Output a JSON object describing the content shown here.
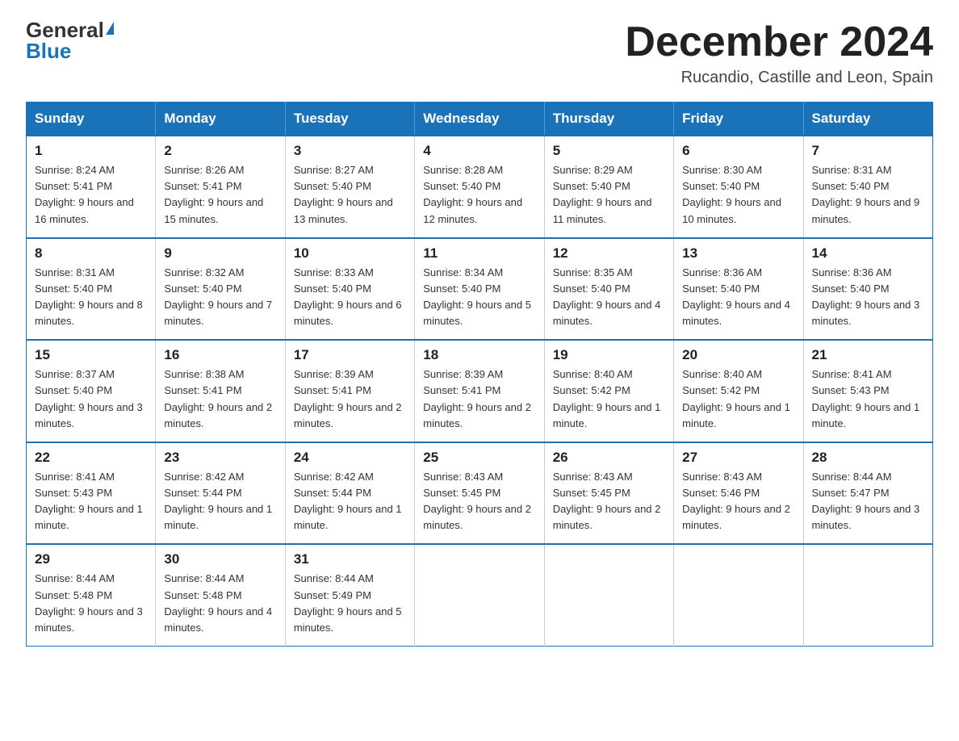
{
  "header": {
    "logo_general": "General",
    "logo_blue": "Blue",
    "month_title": "December 2024",
    "location": "Rucandio, Castille and Leon, Spain"
  },
  "days_of_week": [
    "Sunday",
    "Monday",
    "Tuesday",
    "Wednesday",
    "Thursday",
    "Friday",
    "Saturday"
  ],
  "weeks": [
    [
      {
        "num": "1",
        "sunrise": "8:24 AM",
        "sunset": "5:41 PM",
        "daylight": "9 hours and 16 minutes."
      },
      {
        "num": "2",
        "sunrise": "8:26 AM",
        "sunset": "5:41 PM",
        "daylight": "9 hours and 15 minutes."
      },
      {
        "num": "3",
        "sunrise": "8:27 AM",
        "sunset": "5:40 PM",
        "daylight": "9 hours and 13 minutes."
      },
      {
        "num": "4",
        "sunrise": "8:28 AM",
        "sunset": "5:40 PM",
        "daylight": "9 hours and 12 minutes."
      },
      {
        "num": "5",
        "sunrise": "8:29 AM",
        "sunset": "5:40 PM",
        "daylight": "9 hours and 11 minutes."
      },
      {
        "num": "6",
        "sunrise": "8:30 AM",
        "sunset": "5:40 PM",
        "daylight": "9 hours and 10 minutes."
      },
      {
        "num": "7",
        "sunrise": "8:31 AM",
        "sunset": "5:40 PM",
        "daylight": "9 hours and 9 minutes."
      }
    ],
    [
      {
        "num": "8",
        "sunrise": "8:31 AM",
        "sunset": "5:40 PM",
        "daylight": "9 hours and 8 minutes."
      },
      {
        "num": "9",
        "sunrise": "8:32 AM",
        "sunset": "5:40 PM",
        "daylight": "9 hours and 7 minutes."
      },
      {
        "num": "10",
        "sunrise": "8:33 AM",
        "sunset": "5:40 PM",
        "daylight": "9 hours and 6 minutes."
      },
      {
        "num": "11",
        "sunrise": "8:34 AM",
        "sunset": "5:40 PM",
        "daylight": "9 hours and 5 minutes."
      },
      {
        "num": "12",
        "sunrise": "8:35 AM",
        "sunset": "5:40 PM",
        "daylight": "9 hours and 4 minutes."
      },
      {
        "num": "13",
        "sunrise": "8:36 AM",
        "sunset": "5:40 PM",
        "daylight": "9 hours and 4 minutes."
      },
      {
        "num": "14",
        "sunrise": "8:36 AM",
        "sunset": "5:40 PM",
        "daylight": "9 hours and 3 minutes."
      }
    ],
    [
      {
        "num": "15",
        "sunrise": "8:37 AM",
        "sunset": "5:40 PM",
        "daylight": "9 hours and 3 minutes."
      },
      {
        "num": "16",
        "sunrise": "8:38 AM",
        "sunset": "5:41 PM",
        "daylight": "9 hours and 2 minutes."
      },
      {
        "num": "17",
        "sunrise": "8:39 AM",
        "sunset": "5:41 PM",
        "daylight": "9 hours and 2 minutes."
      },
      {
        "num": "18",
        "sunrise": "8:39 AM",
        "sunset": "5:41 PM",
        "daylight": "9 hours and 2 minutes."
      },
      {
        "num": "19",
        "sunrise": "8:40 AM",
        "sunset": "5:42 PM",
        "daylight": "9 hours and 1 minute."
      },
      {
        "num": "20",
        "sunrise": "8:40 AM",
        "sunset": "5:42 PM",
        "daylight": "9 hours and 1 minute."
      },
      {
        "num": "21",
        "sunrise": "8:41 AM",
        "sunset": "5:43 PM",
        "daylight": "9 hours and 1 minute."
      }
    ],
    [
      {
        "num": "22",
        "sunrise": "8:41 AM",
        "sunset": "5:43 PM",
        "daylight": "9 hours and 1 minute."
      },
      {
        "num": "23",
        "sunrise": "8:42 AM",
        "sunset": "5:44 PM",
        "daylight": "9 hours and 1 minute."
      },
      {
        "num": "24",
        "sunrise": "8:42 AM",
        "sunset": "5:44 PM",
        "daylight": "9 hours and 1 minute."
      },
      {
        "num": "25",
        "sunrise": "8:43 AM",
        "sunset": "5:45 PM",
        "daylight": "9 hours and 2 minutes."
      },
      {
        "num": "26",
        "sunrise": "8:43 AM",
        "sunset": "5:45 PM",
        "daylight": "9 hours and 2 minutes."
      },
      {
        "num": "27",
        "sunrise": "8:43 AM",
        "sunset": "5:46 PM",
        "daylight": "9 hours and 2 minutes."
      },
      {
        "num": "28",
        "sunrise": "8:44 AM",
        "sunset": "5:47 PM",
        "daylight": "9 hours and 3 minutes."
      }
    ],
    [
      {
        "num": "29",
        "sunrise": "8:44 AM",
        "sunset": "5:48 PM",
        "daylight": "9 hours and 3 minutes."
      },
      {
        "num": "30",
        "sunrise": "8:44 AM",
        "sunset": "5:48 PM",
        "daylight": "9 hours and 4 minutes."
      },
      {
        "num": "31",
        "sunrise": "8:44 AM",
        "sunset": "5:49 PM",
        "daylight": "9 hours and 5 minutes."
      },
      null,
      null,
      null,
      null
    ]
  ],
  "sunrise_label": "Sunrise:",
  "sunset_label": "Sunset:",
  "daylight_label": "Daylight:"
}
